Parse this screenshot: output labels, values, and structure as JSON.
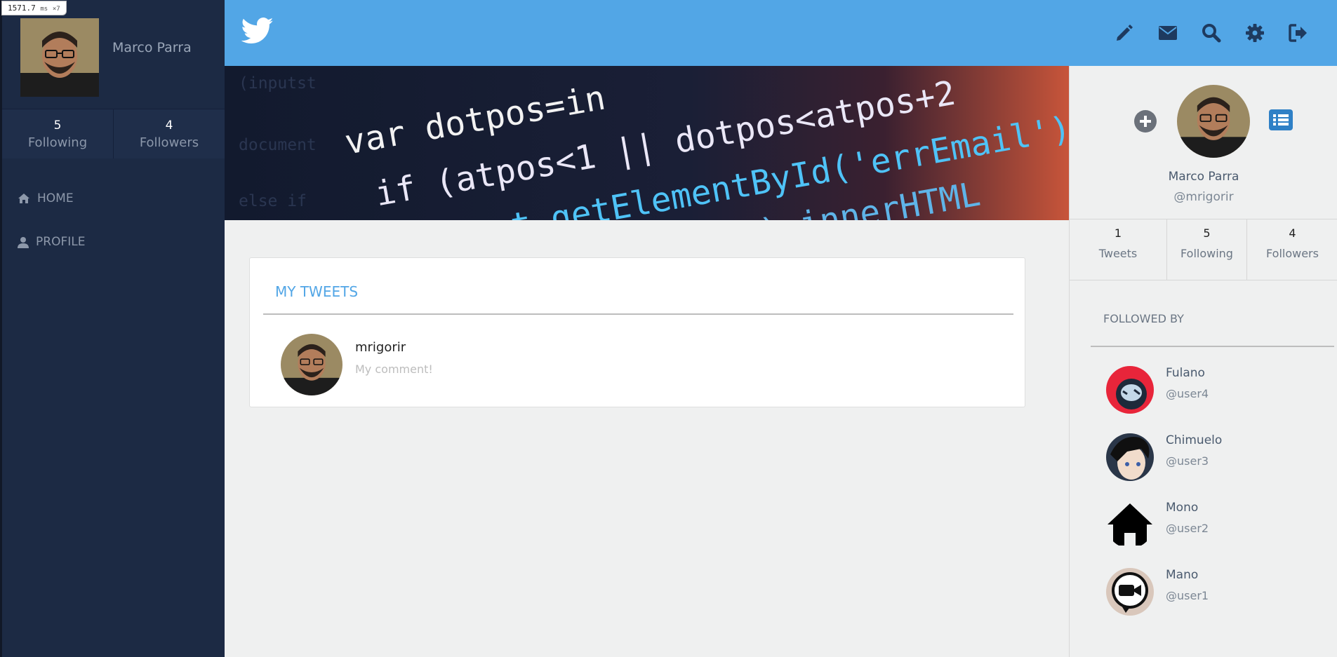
{
  "debug": {
    "time": "1571.7",
    "unit": "ms",
    "count": "×7"
  },
  "sidebar": {
    "user_name": "Marco Parra",
    "stats": [
      {
        "value": "5",
        "label": "Following"
      },
      {
        "value": "4",
        "label": "Followers"
      }
    ],
    "nav": [
      {
        "label": "HOME",
        "icon": "home-icon"
      },
      {
        "label": "PROFILE",
        "icon": "user-icon"
      }
    ]
  },
  "header": {
    "logo_icon": "twitter-bird-icon",
    "actions": [
      "compose-icon",
      "envelope-icon",
      "search-icon",
      "gear-icon",
      "sign-out-icon"
    ],
    "brand_color": "#52a6e6"
  },
  "banner": {
    "code_lines": [
      "var dotpos=in",
      "if (atpos<1 || dotpos<atpos+2",
      "document.getElementById('errEmail').innerHTML",
      "tById(div).innerHTML"
    ]
  },
  "tweets": {
    "title": "MY TWEETS",
    "items": [
      {
        "user": "mrigorir",
        "text": "My comment!"
      }
    ]
  },
  "profile": {
    "name": "Marco Parra",
    "handle": "@mrigorir",
    "stats": [
      {
        "value": "1",
        "label": "Tweets"
      },
      {
        "value": "5",
        "label": "Following"
      },
      {
        "value": "4",
        "label": "Followers"
      }
    ]
  },
  "followed_by": {
    "title": "FOLLOWED BY",
    "users": [
      {
        "name": "Fulano",
        "handle": "@user4"
      },
      {
        "name": "Chimuelo",
        "handle": "@user3"
      },
      {
        "name": "Mono",
        "handle": "@user2"
      },
      {
        "name": "Mano",
        "handle": "@user1"
      }
    ]
  }
}
